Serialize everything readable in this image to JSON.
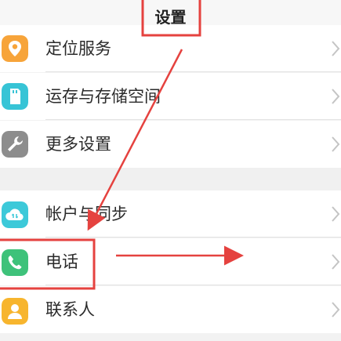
{
  "header": {
    "title": "设置"
  },
  "rows": [
    {
      "label": "定位服务",
      "icon": "location-icon",
      "color": "#f7a43a"
    },
    {
      "label": "运存与存储空间",
      "icon": "storage-icon",
      "color": "#37c4d6"
    },
    {
      "label": "更多设置",
      "icon": "wrench-icon",
      "color": "#8d8d8d"
    },
    {
      "label": "帐户与同步",
      "icon": "cloud-sync-icon",
      "color": "#3cc9d9"
    },
    {
      "label": "电话",
      "icon": "phone-icon",
      "color": "#3ec27a"
    },
    {
      "label": "联系人",
      "icon": "contacts-icon",
      "color": "#f7b52e"
    }
  ],
  "annotation_color": "#e5423f"
}
